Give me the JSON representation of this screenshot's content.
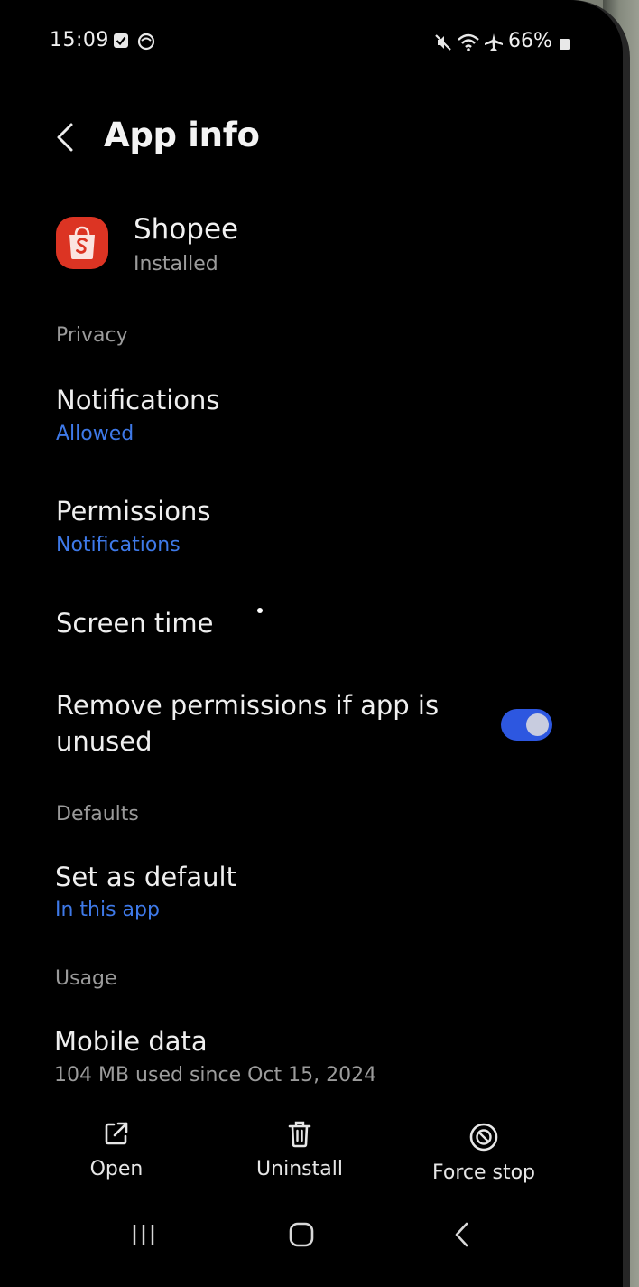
{
  "status_bar": {
    "time": "15:09",
    "battery_percent": "66%",
    "left_icons": [
      "notification-checkbox-icon",
      "app-notification-icon"
    ],
    "right_icons": [
      "mute-icon",
      "wifi-icon",
      "airplane-icon",
      "battery-icon"
    ]
  },
  "header": {
    "title": "App info",
    "back_icon": "chevron-left-icon"
  },
  "app": {
    "name": "Shopee",
    "status": "Installed",
    "icon": "shopee-bag-icon",
    "icon_color": "#dc3423"
  },
  "sections": {
    "privacy": {
      "header": "Privacy",
      "notifications": {
        "title": "Notifications",
        "value": "Allowed"
      },
      "permissions": {
        "title": "Permissions",
        "value": "Notifications"
      },
      "screen_time": {
        "title": "Screen time"
      },
      "remove_permissions": {
        "title_line1": "Remove permissions if app is",
        "title_line2": "unused",
        "toggle_on": true
      }
    },
    "defaults": {
      "header": "Defaults",
      "set_as_default": {
        "title": "Set as default",
        "value": "In this app"
      }
    },
    "usage": {
      "header": "Usage",
      "mobile_data": {
        "title": "Mobile data",
        "value": "104 MB used since Oct 15, 2024"
      }
    }
  },
  "actions": {
    "open": {
      "label": "Open",
      "icon": "open-external-icon"
    },
    "uninstall": {
      "label": "Uninstall",
      "icon": "trash-icon"
    },
    "force_stop": {
      "label": "Force stop",
      "icon": "force-stop-icon"
    }
  },
  "nav_bar": {
    "icons": [
      "recent-apps-icon",
      "home-icon",
      "back-nav-icon"
    ]
  },
  "colors": {
    "accent_link": "#3e79e8",
    "toggle_on": "#2d57e0",
    "background": "#000000"
  }
}
